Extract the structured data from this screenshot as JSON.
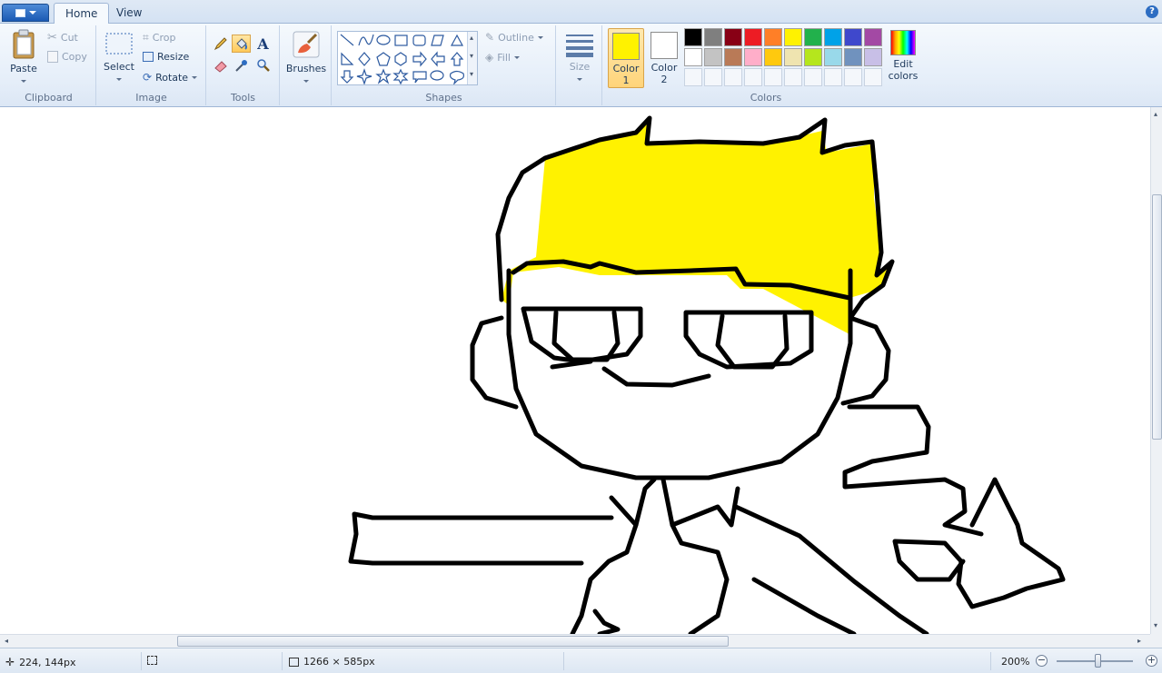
{
  "tabs": {
    "home": "Home",
    "view": "View"
  },
  "help": "?",
  "clipboard": {
    "paste": "Paste",
    "cut": "Cut",
    "copy": "Copy",
    "group": "Clipboard"
  },
  "image": {
    "select": "Select",
    "crop": "Crop",
    "resize": "Resize",
    "rotate": "Rotate",
    "group": "Image"
  },
  "tools": {
    "group": "Tools",
    "text_glyph": "A",
    "active_tool": "fill-bucket"
  },
  "brushes": {
    "label": "Brushes"
  },
  "shapes": {
    "outline": "Outline",
    "fill": "Fill",
    "group": "Shapes"
  },
  "size": {
    "label": "Size"
  },
  "colors": {
    "color1_label": "Color",
    "color1_num": "1",
    "color1_value": "#fff200",
    "color2_label": "Color",
    "color2_num": "2",
    "color2_value": "#ffffff",
    "edit_label": "Edit",
    "edit_label2": "colors",
    "group": "Colors",
    "palette_row1": [
      "#000000",
      "#7f7f7f",
      "#880015",
      "#ed1c24",
      "#ff7f27",
      "#fff200",
      "#22b14c",
      "#00a2e8",
      "#3f48cc",
      "#a349a4"
    ],
    "palette_row2": [
      "#ffffff",
      "#c3c3c3",
      "#b97a57",
      "#ffaec9",
      "#ffc90e",
      "#efe4b0",
      "#b5e61d",
      "#99d9ea",
      "#7092be",
      "#c8bfe7"
    ]
  },
  "status": {
    "cursor": "224, 144px",
    "size": "1266 × 585px",
    "zoom": "200%",
    "zoom_level_fraction": 0.55
  }
}
